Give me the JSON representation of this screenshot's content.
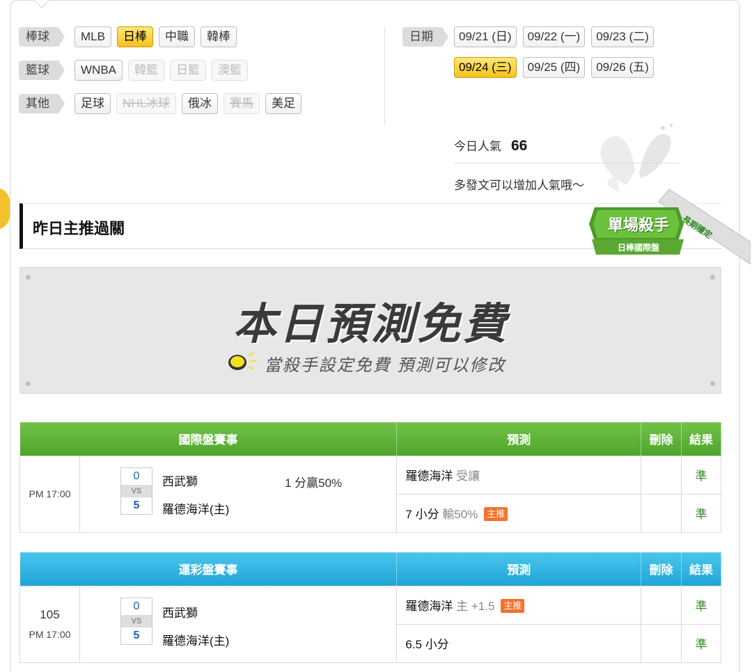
{
  "filters": {
    "rows": [
      {
        "category": "棒球",
        "chips": [
          {
            "label": "MLB",
            "state": "normal"
          },
          {
            "label": "日棒",
            "state": "active"
          },
          {
            "label": "中職",
            "state": "normal"
          },
          {
            "label": "韓棒",
            "state": "normal"
          }
        ]
      },
      {
        "category": "籃球",
        "chips": [
          {
            "label": "WNBA",
            "state": "normal"
          },
          {
            "label": "韓籃",
            "state": "disabled"
          },
          {
            "label": "日籃",
            "state": "disabled"
          },
          {
            "label": "澳籃",
            "state": "disabled"
          }
        ]
      },
      {
        "category": "其他",
        "chips": [
          {
            "label": "足球",
            "state": "normal"
          },
          {
            "label": "NHL冰球",
            "state": "disabled-strike"
          },
          {
            "label": "俄冰",
            "state": "normal"
          },
          {
            "label": "賽馬",
            "state": "disabled-strike"
          },
          {
            "label": "美足",
            "state": "normal"
          }
        ]
      }
    ]
  },
  "dates": {
    "label": "日期",
    "items": [
      {
        "label": "09/21 (日)",
        "active": false
      },
      {
        "label": "09/22 (一)",
        "active": false
      },
      {
        "label": "09/23 (二)",
        "active": false
      },
      {
        "label": "09/24 (三)",
        "active": true
      },
      {
        "label": "09/25 (四)",
        "active": false
      },
      {
        "label": "09/26 (五)",
        "active": false
      }
    ]
  },
  "popularity": {
    "label": "今日人氣",
    "value": "66",
    "tip": "多發文可以增加人氣哦～"
  },
  "section": {
    "title": "昨日主推過關"
  },
  "badge": {
    "title": "單場殺手",
    "subtitle": "日棒國際盤",
    "ribbon": "長期穩定"
  },
  "banner": {
    "main": "本日預測免費",
    "sub": "當殺手設定免費  預測可以修改"
  },
  "international": {
    "headers": {
      "event": "國際盤賽事",
      "prediction": "預測",
      "delete": "刪除",
      "result": "結果"
    },
    "time": "PM 17:00",
    "away_score": "0",
    "home_score": "5",
    "vs": "VS",
    "away_team": "西武獅",
    "home_team": "羅德海洋(主)",
    "handicap": "1 分贏50%",
    "predictions": [
      {
        "main": "羅德海洋",
        "detail": "受讓",
        "tag": "",
        "result": "準"
      },
      {
        "main": "7 小分",
        "detail": "輸50%",
        "tag": "主推",
        "result": "準"
      }
    ]
  },
  "lottery": {
    "headers": {
      "event": "運彩盤賽事",
      "prediction": "預測",
      "delete": "刪除",
      "result": "結果"
    },
    "number": "105",
    "time": "PM 17:00",
    "away_score": "0",
    "home_score": "5",
    "vs": "VS",
    "away_team": "西武獅",
    "home_team": "羅德海洋(主)",
    "predictions": [
      {
        "main": "羅德海洋",
        "detail": "主 +1.5",
        "tag": "主推",
        "result": "準"
      },
      {
        "main": "6.5 小分",
        "detail": "",
        "tag": "",
        "result": "準"
      }
    ]
  },
  "colors": {
    "accent_yellow": "#f4c21d",
    "header_green": "#4ea52a",
    "header_blue": "#1fa5d6",
    "result_green": "#2d8a1d",
    "tag_orange": "#f5712b"
  }
}
